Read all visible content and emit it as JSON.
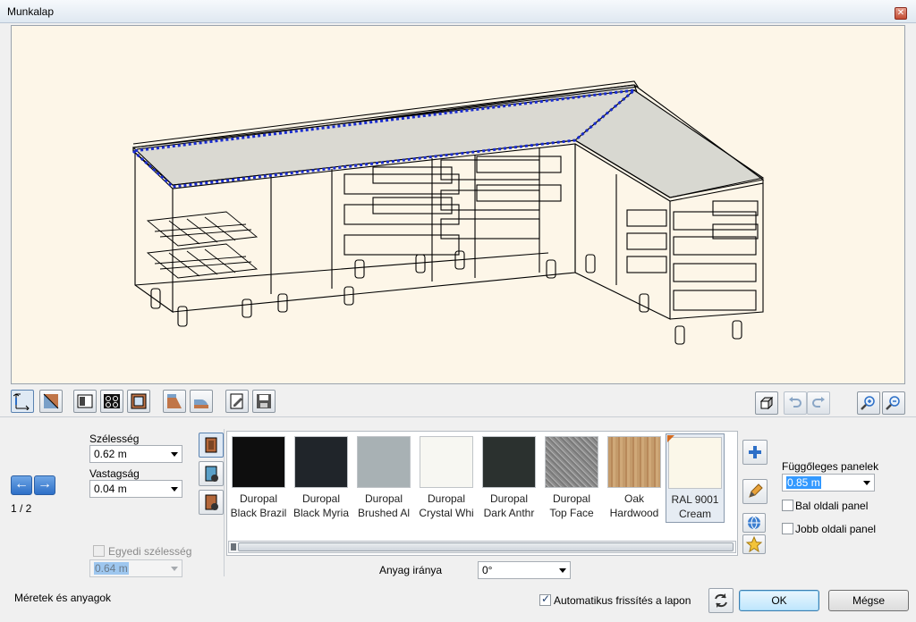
{
  "window": {
    "title": "Munkalap",
    "close_icon": "close-icon"
  },
  "toolbar": {
    "left_buttons": [
      "dimensions-icon",
      "profile-icon",
      "front-panel-icon",
      "hob-icon",
      "frame-icon",
      "edge-icon",
      "edge-round-icon",
      "edit-sheet-icon",
      "save-icon"
    ],
    "right_buttons": [
      "box-view-icon",
      "undo-icon",
      "redo-icon",
      "zoom-in-icon",
      "zoom-out-icon"
    ]
  },
  "dimensions": {
    "width_label": "Szélesség",
    "width_value": "0.62 m",
    "thickness_label": "Vastagság",
    "thickness_value": "0.04 m",
    "custom_width_label": "Egyedi szélesség",
    "custom_width_value": "0.64 m",
    "page_indicator": "1 / 2"
  },
  "materials": {
    "swatches": [
      {
        "line1": "Duropal",
        "line2": "Black Brazil",
        "color": "#0e0e0e"
      },
      {
        "line1": "Duropal",
        "line2": "Black Myria",
        "color": "#20252a"
      },
      {
        "line1": "Duropal",
        "line2": "Brushed Al",
        "color": "#a8b1b4"
      },
      {
        "line1": "Duropal",
        "line2": "Crystal Whi",
        "color": "#f7f7f2"
      },
      {
        "line1": "Duropal",
        "line2": "Dark Anthr",
        "color": "#2b312f"
      },
      {
        "line1": "Duropal",
        "line2": "Top Face",
        "color": "#8d8d8d"
      },
      {
        "line1": "Oak",
        "line2": "Hardwood",
        "color": "#c49b6b"
      },
      {
        "line1": "RAL 9001",
        "line2": "Cream",
        "color": "#fbf7e9"
      }
    ],
    "direction_label": "Anyag iránya",
    "direction_value": "0°"
  },
  "vertical_panels": {
    "label": "Függőleges panelek",
    "value": "0.85 m",
    "left_panel_label": "Bal oldali panel",
    "right_panel_label": "Jobb oldali panel"
  },
  "footer": {
    "status": "Méretek és anyagok",
    "auto_refresh_label": "Automatikus frissítés a lapon",
    "ok_label": "OK",
    "cancel_label": "Mégse"
  },
  "colors": {
    "viewport_bg": "#fdf6e8",
    "selection_outline": "#1a2ccf",
    "accent": "#2d6fc7"
  }
}
